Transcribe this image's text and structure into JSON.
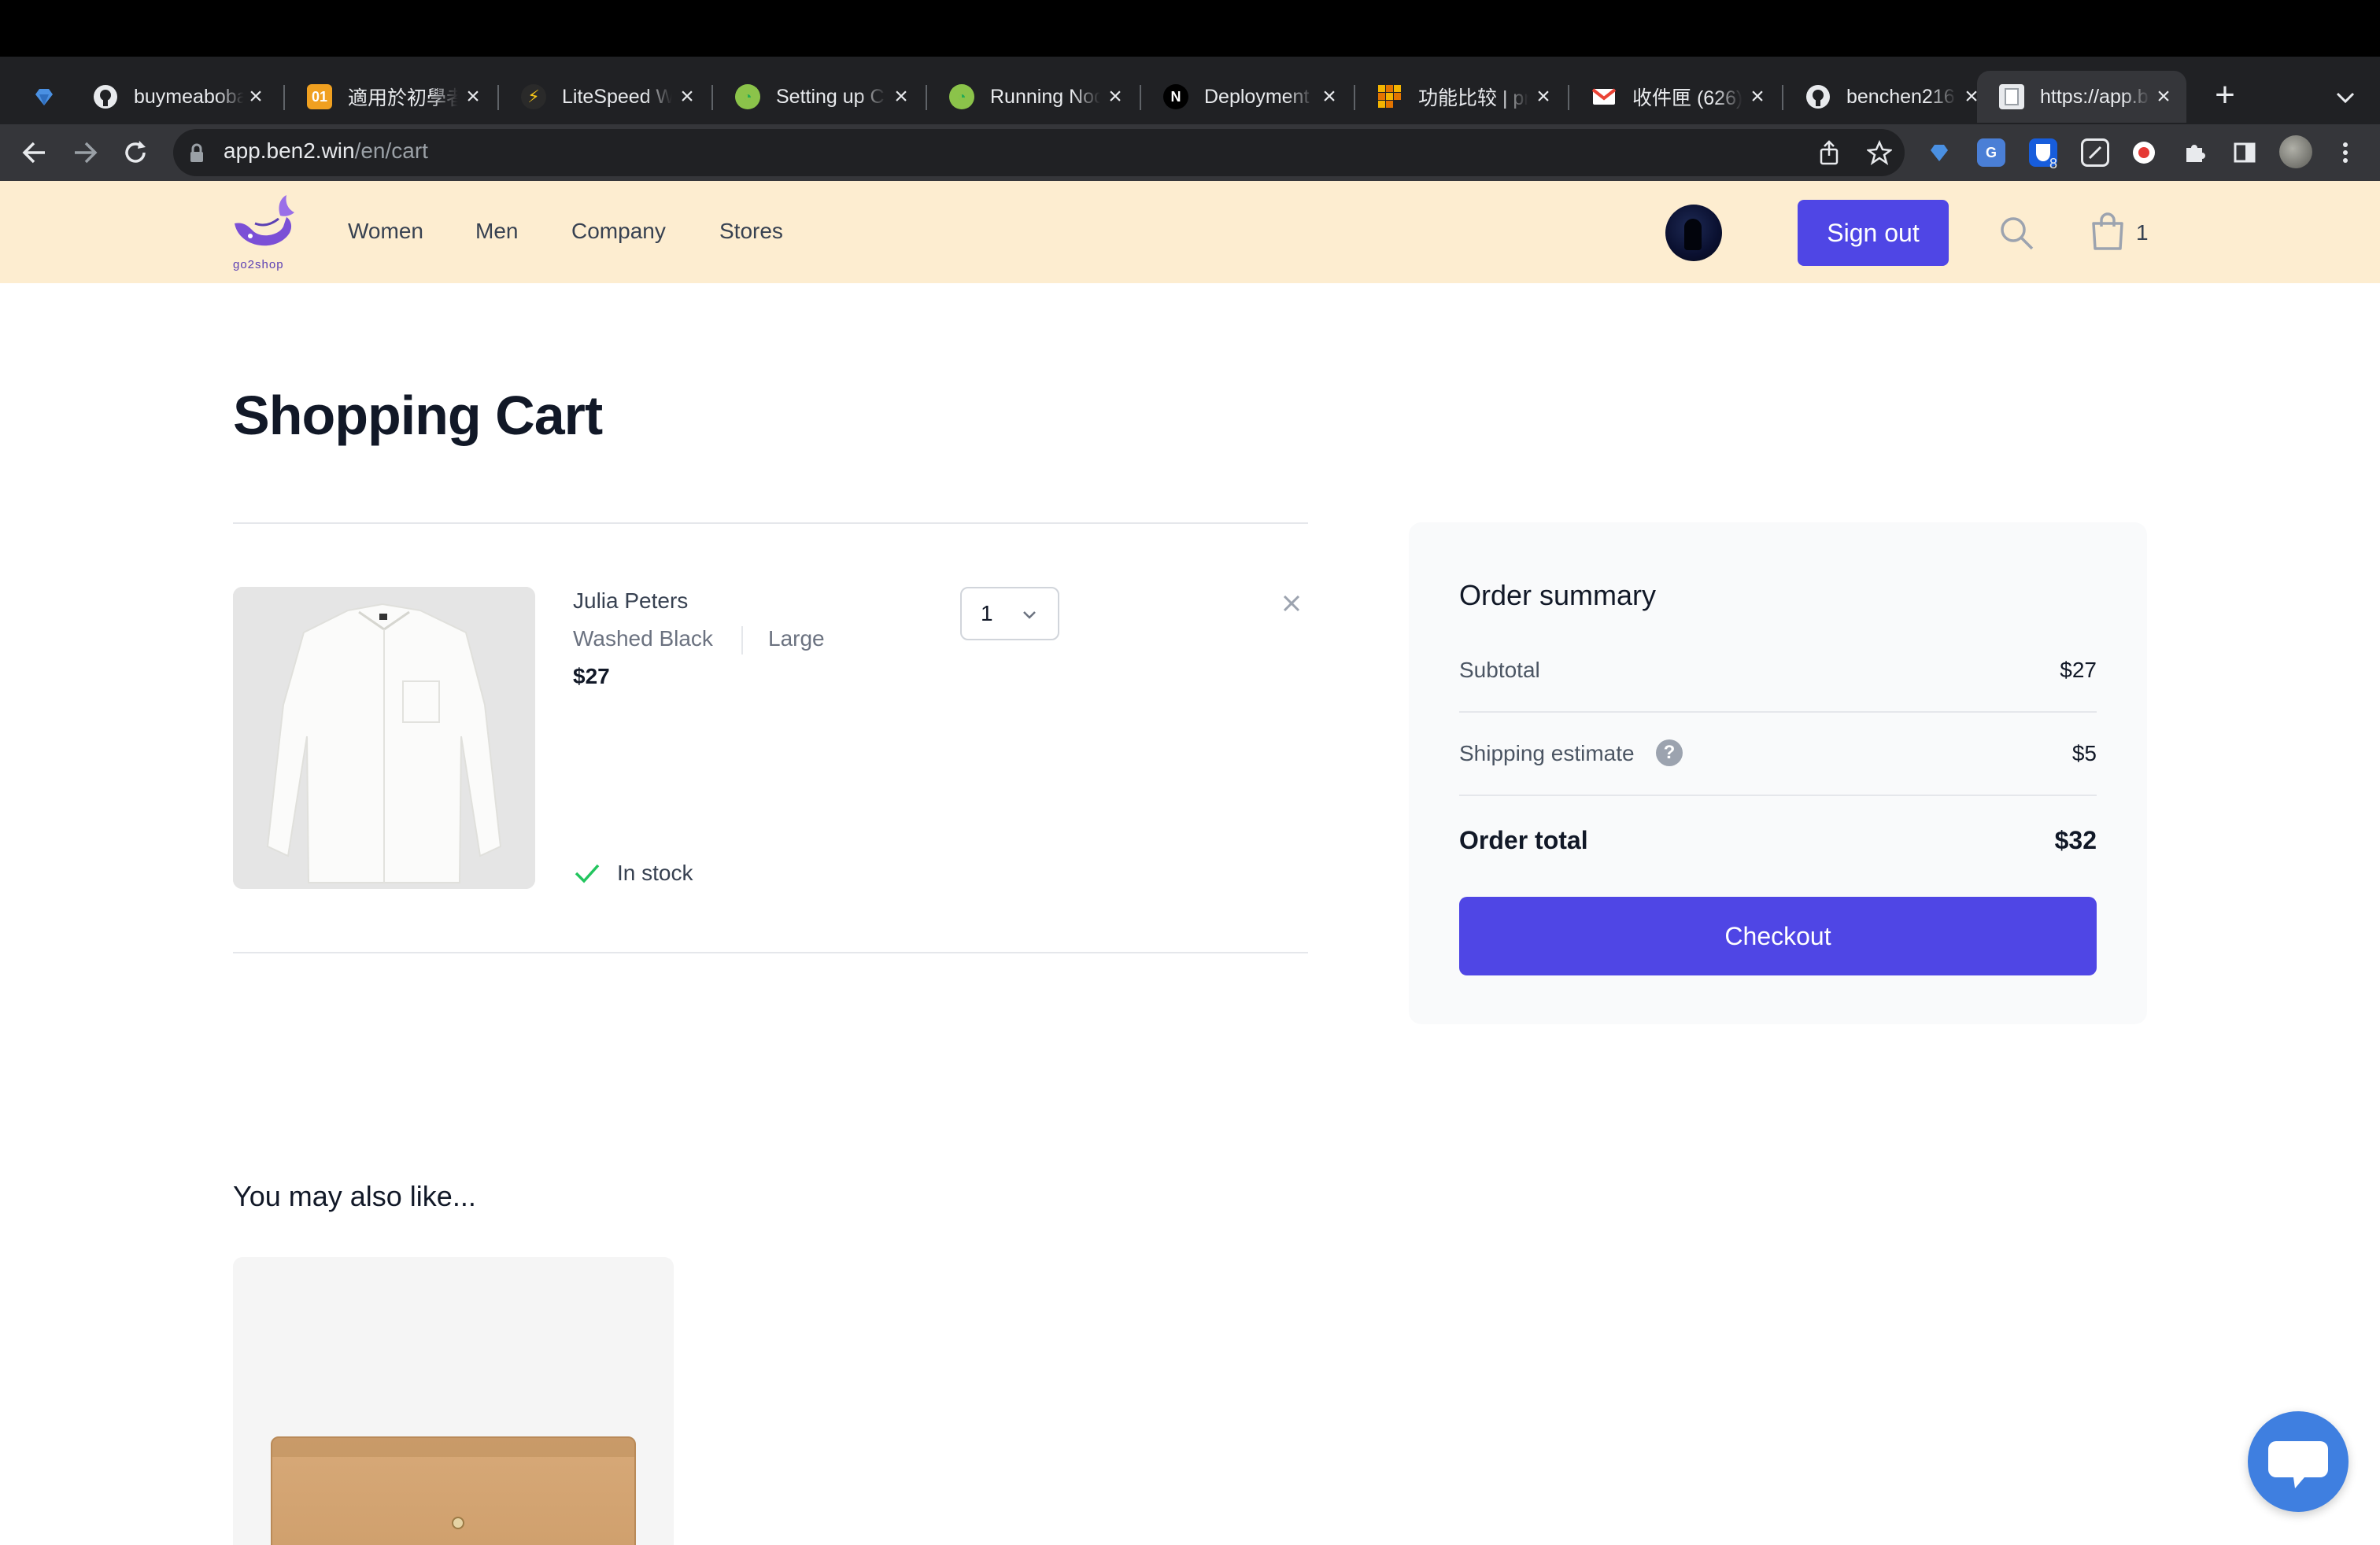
{
  "browser": {
    "tabs": [
      {
        "label": "",
        "icon": "sapphire-icon",
        "active": false
      },
      {
        "label": "buymeaboba",
        "icon": "github-icon",
        "active": false
      },
      {
        "label": "適用於初學者",
        "icon": "01-icon",
        "active": false
      },
      {
        "label": "LiteSpeed W",
        "icon": "litespeed-icon",
        "active": false
      },
      {
        "label": "Setting up C",
        "icon": "cyberpanel-icon",
        "active": false
      },
      {
        "label": "Running Nod",
        "icon": "cyberpanel-icon",
        "active": false
      },
      {
        "label": "Deployment",
        "icon": "nextjs-icon",
        "active": false
      },
      {
        "label": "功能比较 | pr",
        "icon": "grid-icon",
        "active": false
      },
      {
        "label": "收件匣 (626)",
        "icon": "gmail-icon",
        "active": false
      },
      {
        "label": "benchen216",
        "icon": "github-icon",
        "active": false
      },
      {
        "label": "https://app.b",
        "icon": "page-icon",
        "active": true
      }
    ],
    "url_host": "app.ben2.win",
    "url_path": "/en/cart",
    "extension_badge": "8"
  },
  "header": {
    "logo_text": "go2shop",
    "nav": [
      "Women",
      "Men",
      "Company",
      "Stores"
    ],
    "sign_out_label": "Sign out",
    "cart_count": "1"
  },
  "cart": {
    "title": "Shopping Cart",
    "item": {
      "name": "Julia Peters",
      "color": "Washed Black",
      "size": "Large",
      "price": "$27",
      "quantity": "1",
      "stock_status": "In stock"
    }
  },
  "summary": {
    "title": "Order summary",
    "subtotal_label": "Subtotal",
    "subtotal_value": "$27",
    "shipping_label": "Shipping estimate",
    "shipping_value": "$5",
    "total_label": "Order total",
    "total_value": "$32",
    "checkout_label": "Checkout"
  },
  "recommendations": {
    "title": "You may also like..."
  },
  "colors": {
    "accent": "#4f46e5",
    "header_bg": "#fdedd0",
    "chat": "#3f7fe0"
  }
}
